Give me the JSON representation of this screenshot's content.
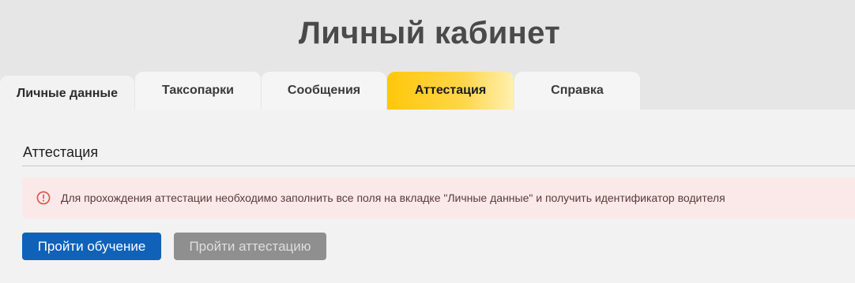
{
  "header": {
    "title": "Личный кабинет"
  },
  "tabs": [
    {
      "label": "Личные данные",
      "active": false
    },
    {
      "label": "Таксопарки",
      "active": false
    },
    {
      "label": "Сообщения",
      "active": false
    },
    {
      "label": "Аттестация",
      "active": true
    },
    {
      "label": "Справка",
      "active": false
    }
  ],
  "section": {
    "title": "Аттестация"
  },
  "alert": {
    "icon": "error-circle-icon",
    "text": "Для прохождения аттестации необходимо заполнить все поля на вкладке \"Личные данные\" и получить идентификатор водителя"
  },
  "actions": {
    "training_label": "Пройти обучение",
    "attestation_label": "Пройти аттестацию",
    "attestation_disabled": true
  },
  "colors": {
    "accent_tab": "#ffc70a",
    "primary_button": "#0f62b8",
    "disabled_button": "#8f8f8f",
    "alert_background": "#fbe9e9",
    "alert_icon": "#d9534f"
  }
}
